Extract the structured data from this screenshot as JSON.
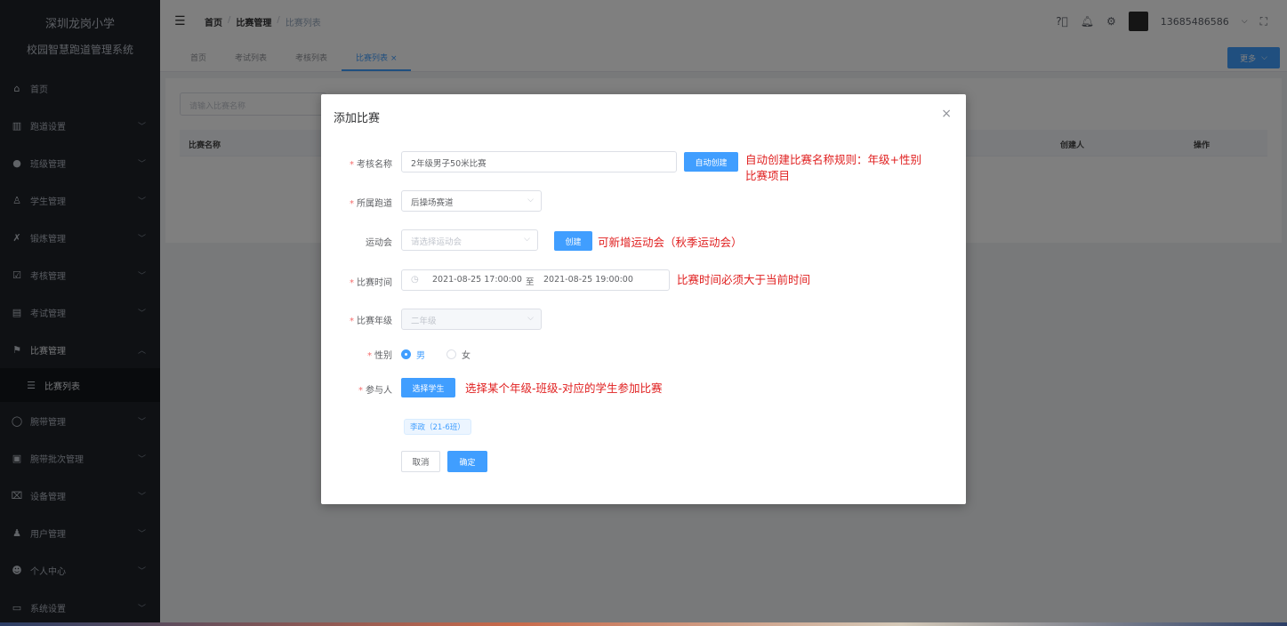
{
  "sidebar": {
    "school": "深圳龙岗小学",
    "system": "校园智慧跑道管理系统",
    "items": [
      {
        "icon": "home-icon",
        "glyph": "⌂",
        "label": "首页",
        "has_children": false
      },
      {
        "icon": "track-icon",
        "glyph": "▥",
        "label": "跑道设置",
        "has_children": true
      },
      {
        "icon": "class-icon",
        "glyph": "●",
        "label": "班级管理",
        "has_children": true
      },
      {
        "icon": "student-icon",
        "glyph": "♙",
        "label": "学生管理",
        "has_children": true
      },
      {
        "icon": "training-icon",
        "glyph": "✗",
        "label": "锻炼管理",
        "has_children": true
      },
      {
        "icon": "assessment-icon",
        "glyph": "☑",
        "label": "考核管理",
        "has_children": true
      },
      {
        "icon": "exam-icon",
        "glyph": "▤",
        "label": "考试管理",
        "has_children": true
      },
      {
        "icon": "flag-icon",
        "glyph": "⚑",
        "label": "比赛管理",
        "has_children": true,
        "expanded": true
      },
      {
        "icon": "list-icon",
        "glyph": "☰",
        "label": "比赛列表",
        "sub": true
      },
      {
        "icon": "band-icon",
        "glyph": "◯",
        "label": "腕带管理",
        "has_children": true
      },
      {
        "icon": "batch-icon",
        "glyph": "▣",
        "label": "腕带批次管理",
        "has_children": true
      },
      {
        "icon": "device-icon",
        "glyph": "⌧",
        "label": "设备管理",
        "has_children": true
      },
      {
        "icon": "user-icon",
        "glyph": "♟",
        "label": "用户管理",
        "has_children": true
      },
      {
        "icon": "person-icon",
        "glyph": "☻",
        "label": "个人中心",
        "has_children": true
      },
      {
        "icon": "settings-icon",
        "glyph": "▭",
        "label": "系统设置",
        "has_children": true
      }
    ]
  },
  "header": {
    "breadcrumb": [
      "首页",
      "比赛管理",
      "比赛列表"
    ],
    "username": "13685486586"
  },
  "tabs": {
    "items": [
      "首页",
      "考试列表",
      "考核列表",
      "比赛列表"
    ],
    "active_index": 3,
    "more_label": "更多"
  },
  "main": {
    "search_placeholder": "请输入比赛名称",
    "columns": [
      "比赛名称",
      "创建人",
      "操作"
    ]
  },
  "dialog": {
    "title": "添加比赛",
    "fields": {
      "name": {
        "label": "考核名称",
        "value": "2年级男子50米比赛",
        "button": "自动创建"
      },
      "track": {
        "label": "所属跑道",
        "value": "后操场赛道"
      },
      "meet": {
        "label": "运动会",
        "placeholder": "请选择运动会",
        "button": "创建"
      },
      "time": {
        "label": "比赛时间",
        "start": "2021-08-25 17:00:00",
        "separator": "至",
        "end": "2021-08-25 19:00:00"
      },
      "grade": {
        "label": "比赛年级",
        "value": "二年级"
      },
      "gender": {
        "label": "性别",
        "options": [
          "男",
          "女"
        ],
        "selected": "男"
      },
      "participants": {
        "label": "参与人",
        "button": "选择学生",
        "tag": "李政（21-6班）"
      }
    },
    "cancel": "取消",
    "confirm": "确定"
  },
  "annotations": {
    "name_rule_line1": "自动创建比赛名称规则：年级+性别",
    "name_rule_line2": "比赛项目",
    "meet_note": "可新增运动会（秋季运动会）",
    "time_note": "比赛时间必须大于当前时间",
    "participant_note": "选择某个年级-班级-对应的学生参加比赛"
  },
  "colors": {
    "primary": "#409eff",
    "sidebar_bg": "#1f2329",
    "annotation": "#e02020"
  }
}
